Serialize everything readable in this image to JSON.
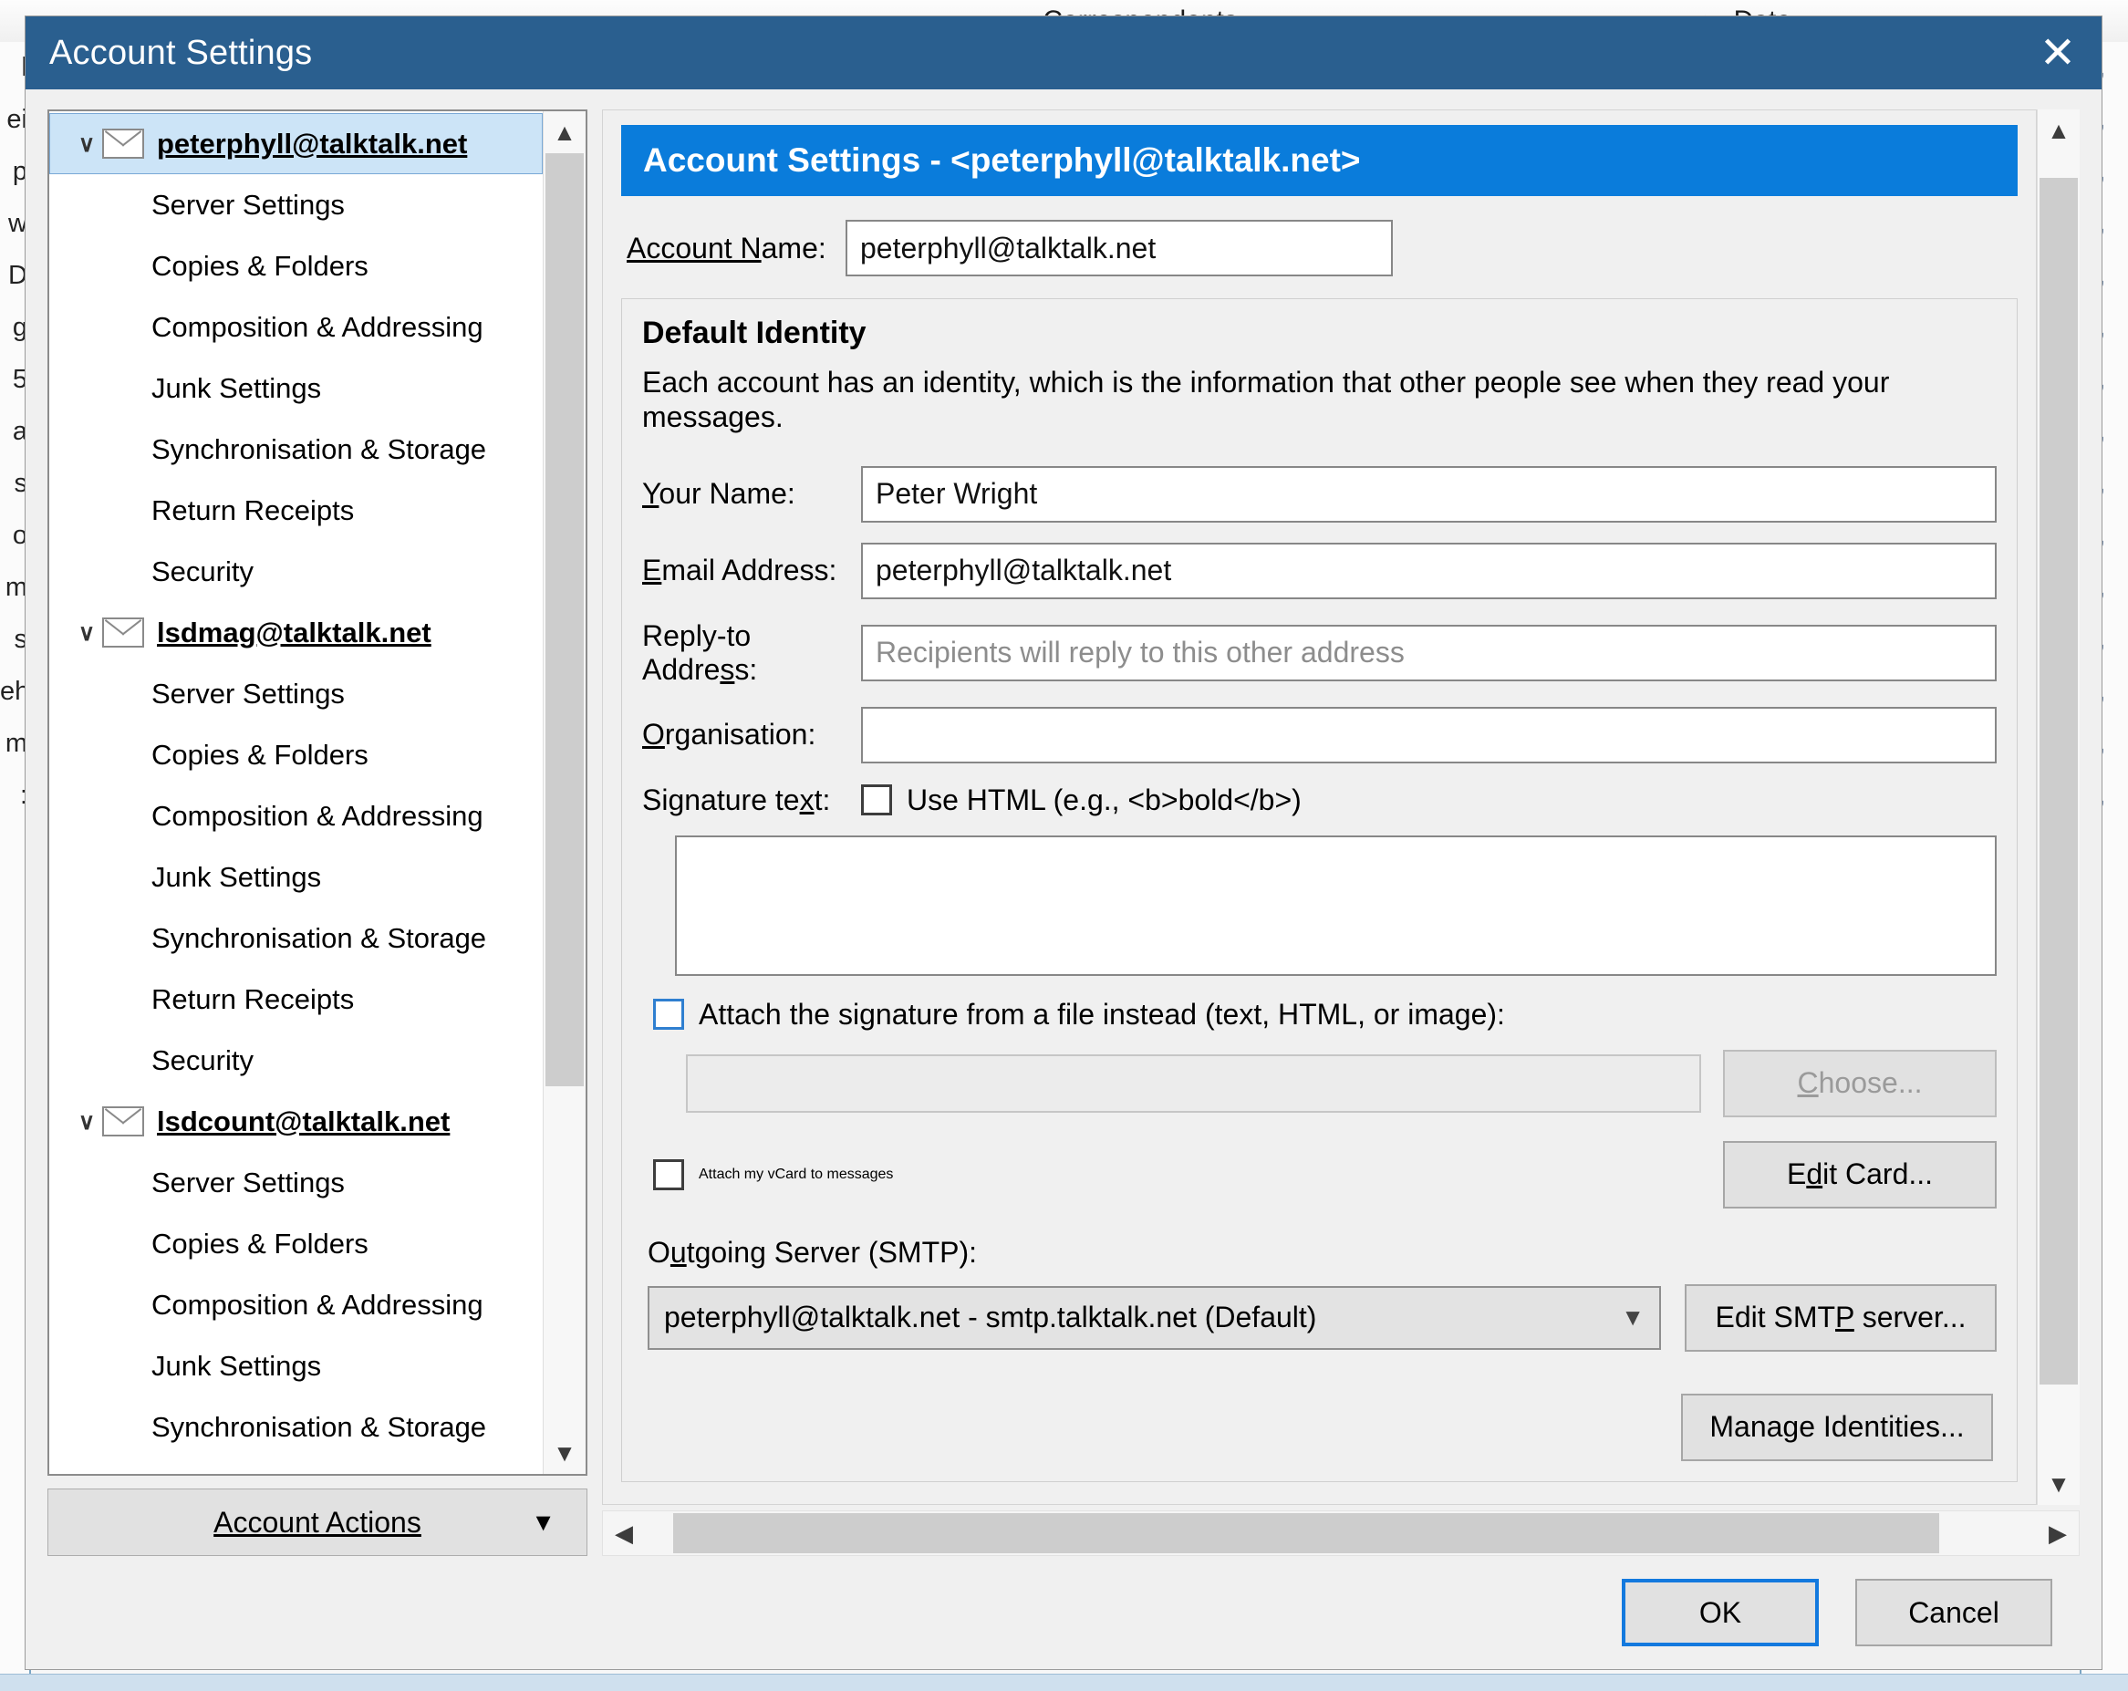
{
  "backdrop": {
    "columns": [
      {
        "icon": "correspondents-icon",
        "label": "Correspondents"
      },
      {
        "icon": "sort-indicator-icon",
        "label": "Date"
      }
    ],
    "left_strip_text": "l\nei\np\nw\nD\ng\n5\na\ns\no\nm\ns\neh\nm\n:",
    "right_strip_text": "0,\n0,\n0,\n0,\n0,\n0,\n0,\n0,\n0,\n0,\n0,\n0,\n0,\n0,\n0,"
  },
  "dialog": {
    "title": "Account Settings",
    "close_icon": "close-icon"
  },
  "sidebar": {
    "tree": [
      {
        "type": "account",
        "label": "peterphyll@talktalk.net",
        "selected": true,
        "icon": "envelope-icon",
        "chevron": "chevron-down-icon"
      },
      {
        "type": "child",
        "label": "Server Settings"
      },
      {
        "type": "child",
        "label": "Copies & Folders"
      },
      {
        "type": "child",
        "label": "Composition & Addressing"
      },
      {
        "type": "child",
        "label": "Junk Settings"
      },
      {
        "type": "child",
        "label": "Synchronisation & Storage"
      },
      {
        "type": "child",
        "label": "Return Receipts"
      },
      {
        "type": "child",
        "label": "Security"
      },
      {
        "type": "account",
        "label": "lsdmag@talktalk.net",
        "selected": false,
        "icon": "envelope-icon",
        "chevron": "chevron-down-icon"
      },
      {
        "type": "child",
        "label": "Server Settings"
      },
      {
        "type": "child",
        "label": "Copies & Folders"
      },
      {
        "type": "child",
        "label": "Composition & Addressing"
      },
      {
        "type": "child",
        "label": "Junk Settings"
      },
      {
        "type": "child",
        "label": "Synchronisation & Storage"
      },
      {
        "type": "child",
        "label": "Return Receipts"
      },
      {
        "type": "child",
        "label": "Security"
      },
      {
        "type": "account",
        "label": "lsdcount@talktalk.net",
        "selected": false,
        "icon": "envelope-icon",
        "chevron": "chevron-down-icon"
      },
      {
        "type": "child",
        "label": "Server Settings"
      },
      {
        "type": "child",
        "label": "Copies & Folders"
      },
      {
        "type": "child",
        "label": "Composition & Addressing"
      },
      {
        "type": "child",
        "label": "Junk Settings"
      },
      {
        "type": "child",
        "label": "Synchronisation & Storage"
      }
    ],
    "account_actions_label": "Account Actions",
    "account_actions_chevron": "chevron-down-icon",
    "scroll": {
      "thumb_top_pct": 0,
      "thumb_height_pct": 73
    }
  },
  "panel": {
    "header": "Account Settings - <peterphyll@talktalk.net>",
    "account_name_label": "Account Name:",
    "account_name_value": "peterphyll@talktalk.net",
    "identity": {
      "legend": "Default Identity",
      "description": "Each account has an identity, which is the information that other people see when they read your messages.",
      "fields": [
        {
          "label": "Your Name:",
          "value": "Peter Wright",
          "placeholder": ""
        },
        {
          "label": "Email Address:",
          "value": "peterphyll@talktalk.net",
          "placeholder": ""
        },
        {
          "label": "Reply-to Address:",
          "value": "",
          "placeholder": "Recipients will reply to this other address"
        },
        {
          "label": "Organisation:",
          "value": "",
          "placeholder": ""
        }
      ],
      "signature_label": "Signature text:",
      "use_html_label": "Use HTML (e.g., <b>bold</b>)",
      "use_html_checked": false,
      "signature_value": "",
      "attach_file_label": "Attach the signature from a file instead (text, HTML, or image):",
      "attach_file_checked": false,
      "file_path_value": "",
      "choose_label": "Choose...",
      "choose_disabled": true,
      "vcard_label": "Attach my vCard to messages",
      "vcard_checked": false,
      "edit_card_label": "Edit Card...",
      "smtp_label": "Outgoing Server (SMTP):",
      "smtp_value": "peterphyll@talktalk.net - smtp.talktalk.net (Default)",
      "smtp_chevron": "chevron-down-icon",
      "edit_smtp_label": "Edit SMTP server...",
      "manage_identities_label": "Manage Identities..."
    },
    "scroll": {
      "vthumb_top_pct": 2,
      "vthumb_height_pct": 92
    }
  },
  "footer": {
    "ok_label": "OK",
    "cancel_label": "Cancel"
  },
  "colors": {
    "titlebar": "#2a5f8f",
    "panel_header": "#0a7cdb",
    "selection": "#cce4f7",
    "focus_ring": "#1379de",
    "dialog_bg": "#f0f0f0"
  }
}
